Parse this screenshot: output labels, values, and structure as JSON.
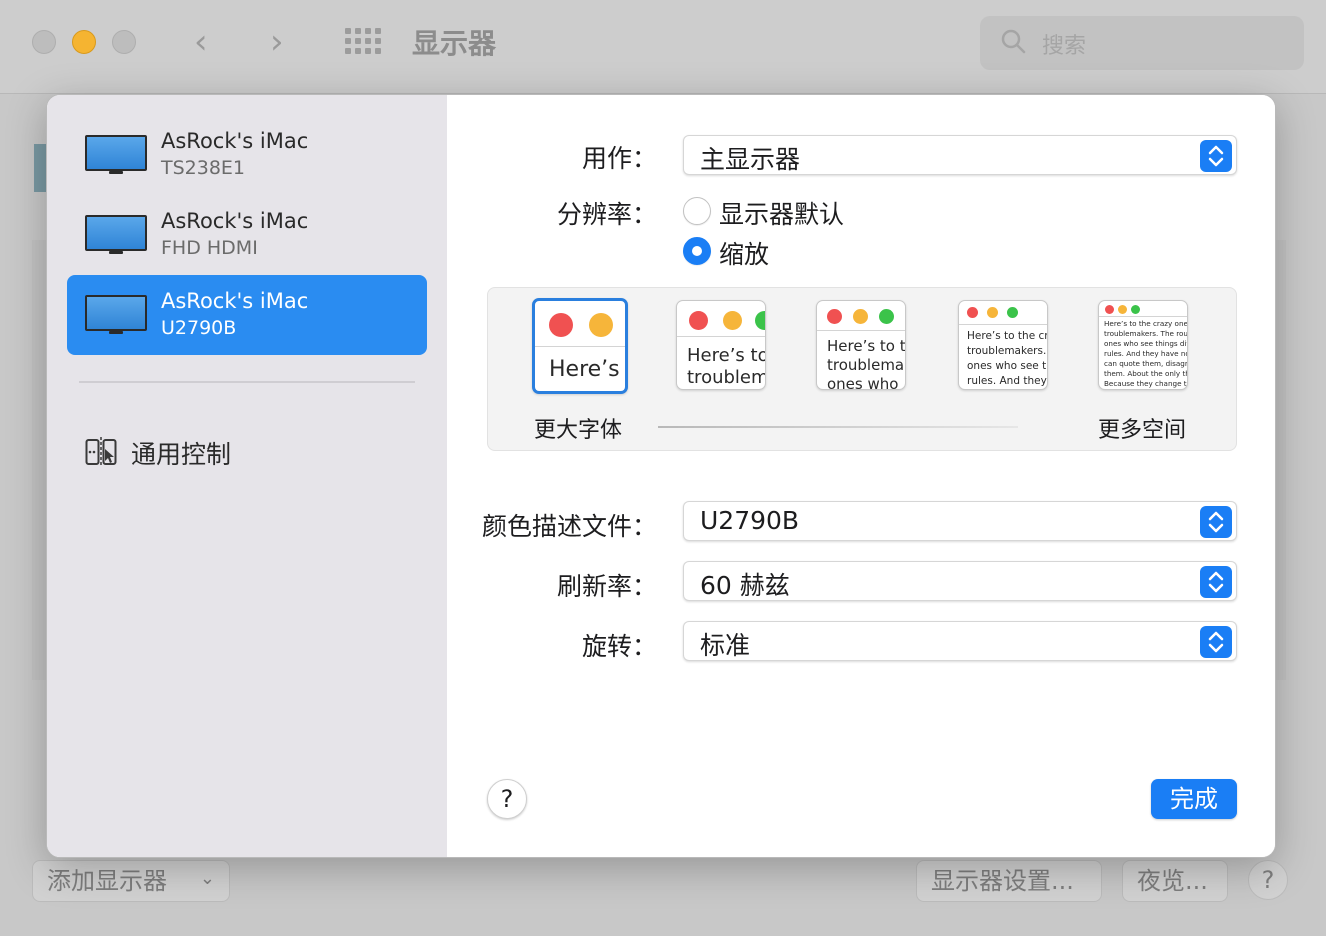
{
  "background": {
    "window_title": "显示器",
    "search_placeholder": "搜索",
    "add_display_label": "添加显示器",
    "display_settings_label": "显示器设置...",
    "night_shift_label": "夜览...",
    "help_label": "?"
  },
  "sidebar": {
    "displays": [
      {
        "name": "AsRock's iMac",
        "model": "TS238E1",
        "selected": false
      },
      {
        "name": "AsRock's iMac",
        "model": "FHD HDMI",
        "selected": false
      },
      {
        "name": "AsRock's iMac",
        "model": "U2790B",
        "selected": true
      }
    ],
    "universal_control_label": "通用控制"
  },
  "settings": {
    "use_as": {
      "label": "用作：",
      "value": "主显示器"
    },
    "resolution": {
      "label": "分辨率：",
      "options": [
        {
          "label": "显示器默认",
          "selected": false
        },
        {
          "label": "缩放",
          "selected": true
        }
      ]
    },
    "scale": {
      "sample_text": "Here's to the crazy ones, the misfits, the rebels, the troublemakers, the round pegs in the square holes, the ones who see things differently. They're not fond of rules. And they have no respect for the status quo. You can quote them, disagree with them. About the only thing you can't do is ignore them. Because they change things.",
      "larger_text_label": "更大字体",
      "more_space_label": "更多空间",
      "options": [
        {
          "text": "Here’s",
          "selected": true
        },
        {
          "text": "Here’s to\ntroublem",
          "selected": false
        },
        {
          "text": "Here’s to t\ntroublema\nones who",
          "selected": false
        },
        {
          "text": "Here’s to the cr\ntroublemakers.\nones who see t\nrules. And they",
          "selected": false
        },
        {
          "text": "Here’s to the crazy one\ntroublemakers. The rou\nones who see things dif\nrules. And they have no\ncan quote them, disagre\nthem. About the only th\nBecause they change th",
          "selected": false
        }
      ]
    },
    "color_profile": {
      "label": "颜色描述文件：",
      "value": "U2790B"
    },
    "refresh_rate": {
      "label": "刷新率：",
      "value": "60 赫兹"
    },
    "rotation": {
      "label": "旋转：",
      "value": "标准"
    },
    "help_label": "?",
    "done_label": "完成"
  },
  "colors": {
    "accent": "#1a7ef5",
    "sidebar_selected": "#2a8cf1",
    "sidebar_bg": "#e6e4e9"
  },
  "icons": {
    "monitor": "monitor-icon",
    "universal_control": "universal-control-icon",
    "search": "search-icon",
    "updown": "updown-chevron-icon"
  }
}
